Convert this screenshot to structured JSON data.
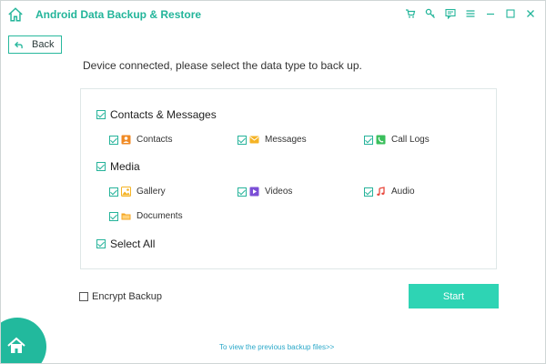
{
  "app": {
    "title": "Android Data Backup & Restore"
  },
  "window_controls": [
    {
      "name": "cart-icon"
    },
    {
      "name": "key-icon"
    },
    {
      "name": "feedback-icon"
    },
    {
      "name": "menu-icon"
    },
    {
      "name": "minimize-icon"
    },
    {
      "name": "maximize-icon"
    },
    {
      "name": "close-icon"
    }
  ],
  "toolbar": {
    "back_label": "Back"
  },
  "instruction": "Device connected, please select the data type to back up.",
  "groups": {
    "contacts_messages": {
      "label": "Contacts & Messages",
      "checked": true,
      "items": [
        {
          "label": "Contacts",
          "icon": "contacts-icon",
          "color": "#f08a24",
          "checked": true
        },
        {
          "label": "Messages",
          "icon": "messages-icon",
          "color": "#f5b324",
          "checked": true
        },
        {
          "label": "Call Logs",
          "icon": "call-logs-icon",
          "color": "#3bbf5c",
          "checked": true
        }
      ]
    },
    "media": {
      "label": "Media",
      "checked": true,
      "items": [
        {
          "label": "Gallery",
          "icon": "gallery-icon",
          "color": "#f5b324",
          "checked": true
        },
        {
          "label": "Videos",
          "icon": "videos-icon",
          "color": "#7b4fd6",
          "checked": true
        },
        {
          "label": "Audio",
          "icon": "audio-icon",
          "color": "#e8473c",
          "checked": true
        },
        {
          "label": "Documents",
          "icon": "documents-icon",
          "color": "#f5a623",
          "checked": true
        }
      ]
    },
    "select_all": {
      "label": "Select All",
      "checked": true
    }
  },
  "encrypt": {
    "label": "Encrypt Backup",
    "checked": false
  },
  "start_label": "Start",
  "previous_link": "To view the previous backup files>>",
  "colors": {
    "accent": "#23b59a",
    "start_button": "#2ed4b4",
    "link": "#2aa8c9"
  }
}
